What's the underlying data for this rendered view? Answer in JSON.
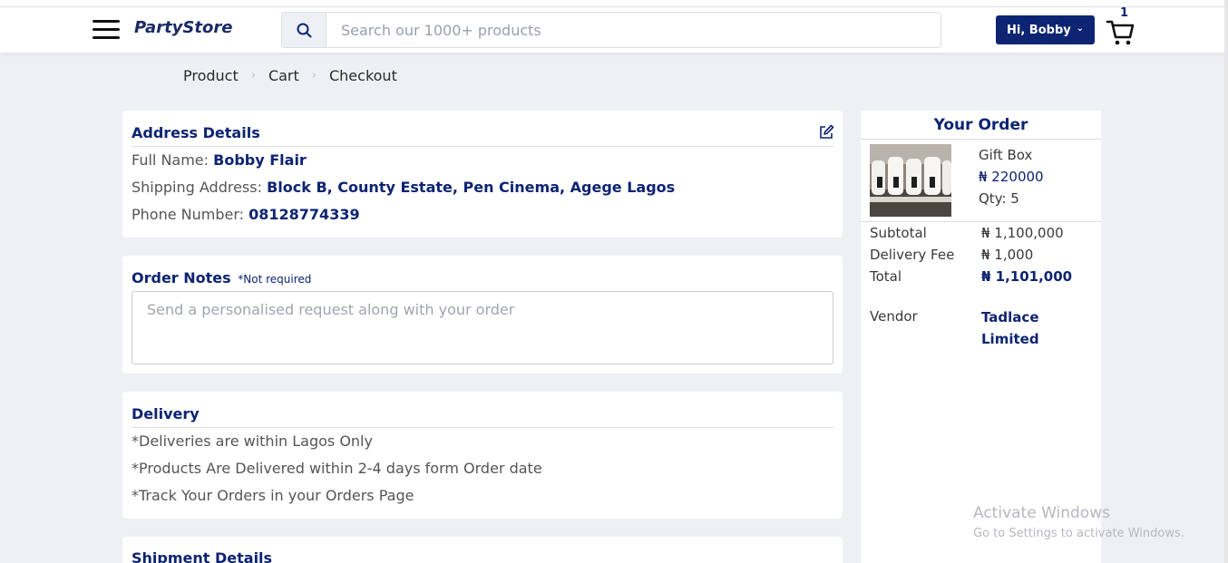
{
  "header": {
    "logo": "PartyStore",
    "search_placeholder": "Search our 1000+ products",
    "user_label": "Hi, Bobby",
    "cart_count": "1"
  },
  "breadcrumb": [
    "Product",
    "Cart",
    "Checkout"
  ],
  "address": {
    "title": "Address Details",
    "full_name_label": "Full Name:",
    "full_name": "Bobby Flair",
    "shipping_label": "Shipping Address:",
    "shipping": "Block B, County Estate, Pen Cinema, Agege Lagos",
    "phone_label": "Phone Number:",
    "phone": "08128774339"
  },
  "notes": {
    "title": "Order Notes",
    "subtitle": "*Not required",
    "placeholder": "Send a personalised request along with your order"
  },
  "delivery": {
    "title": "Delivery",
    "lines": [
      "*Deliveries are within Lagos Only",
      "*Products Are Delivered within 2-4 days form Order date",
      "*Track Your Orders in your Orders Page"
    ]
  },
  "shipment": {
    "title": "Shipment Details"
  },
  "order": {
    "title": "Your Order",
    "product_name": "Gift Box",
    "product_price": "₦ 220000",
    "product_qty": "Qty: 5",
    "subtotal_label": "Subtotal",
    "subtotal": "₦ 1,100,000",
    "delivery_label": "Delivery Fee",
    "delivery": "₦ 1,000",
    "total_label": "Total",
    "total": "₦ 1,101,000",
    "vendor_label": "Vendor",
    "vendor": "Tadlace Limited"
  },
  "watermark": {
    "line1": "Activate Windows",
    "line2": "Go to Settings to activate Windows."
  },
  "colors": {
    "brand": "#0d2472",
    "background": "#eef0f4"
  }
}
